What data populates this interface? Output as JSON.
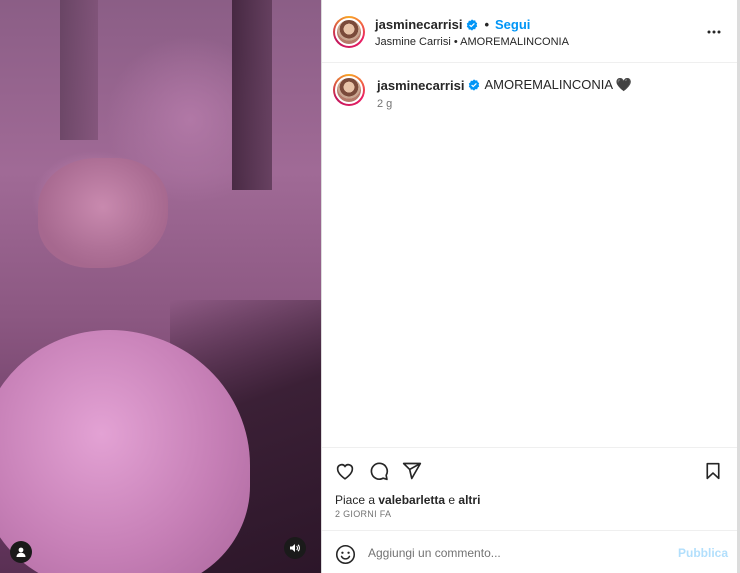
{
  "post": {
    "username": "jasminecarrisi",
    "follow_label": "Segui",
    "subtitle": "Jasmine Carrisi • AMOREMALINCONIA",
    "caption_text": "AMOREMALINCONIA 🖤",
    "caption_time": "2 g",
    "likes_prefix": "Piace a ",
    "likes_user": "valebarletta",
    "likes_middle": " e ",
    "likes_others": "altri",
    "date": "2 GIORNI FA"
  },
  "comment_bar": {
    "placeholder": "Aggiungi un commento...",
    "publish_label": "Pubblica"
  },
  "icons": {
    "verified": "verified-badge-icon",
    "more": "more-options-icon",
    "like": "heart-icon",
    "comment": "comment-icon",
    "share": "share-icon",
    "save": "bookmark-icon",
    "emoji": "emoji-icon",
    "user_tag": "user-tag-icon",
    "audio": "audio-icon"
  },
  "colors": {
    "accent": "#0095f6",
    "publish_disabled": "#b2dffc",
    "verified": "#0095f6"
  }
}
